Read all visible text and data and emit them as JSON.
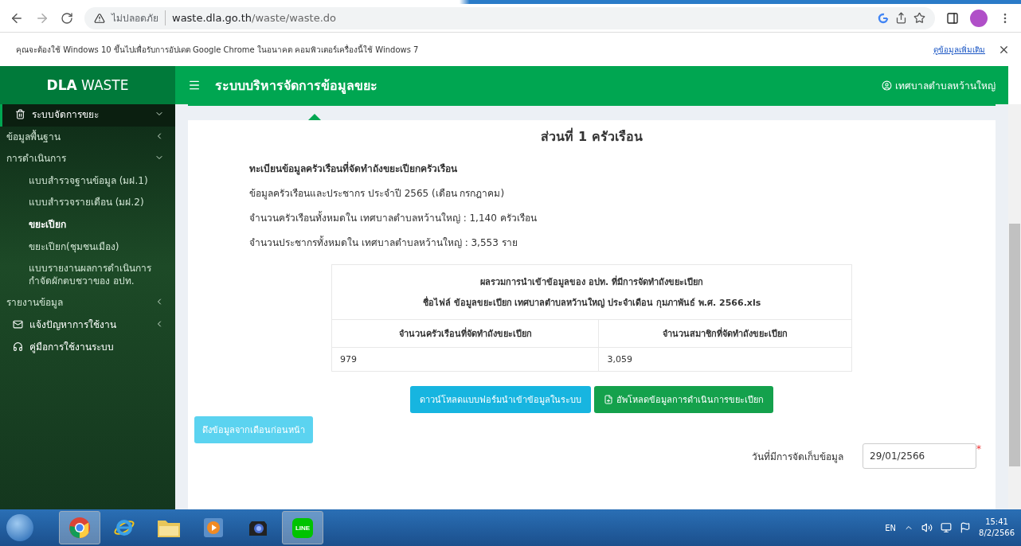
{
  "browser": {
    "security_label": "ไม่ปลอดภัย",
    "url_host": "waste.dla.go.th",
    "url_path": "/waste/waste.do"
  },
  "infobar": {
    "message": "คุณจะต้องใช้ Windows 10 ขึ้นไปเพื่อรับการอัปเดต Google Chrome ในอนาคต คอมพิวเตอร์เครื่องนี้ใช้ Windows 7",
    "link": "ดูข้อมูลเพิ่มเติม"
  },
  "app": {
    "brand_bold": "DLA",
    "brand_rest": "WASTE",
    "title": "ระบบบริหารจัดการข้อมูลขยะ",
    "user": "เทศบาลตำบลหว้านใหญ่"
  },
  "sidebar": {
    "items": [
      {
        "kind": "trash",
        "label": "ระบบจัดการขยะ",
        "expanded": true,
        "children": [
          {
            "label": "ข้อมูลพื้นฐาน",
            "expanded": false
          },
          {
            "label": "การดำเนินการ",
            "expanded": true,
            "children": [
              {
                "label": "แบบสำรวจฐานข้อมูล (มฝ.1)",
                "selected": false
              },
              {
                "label": "แบบสำรวจรายเดือน (มฝ.2)",
                "selected": false
              },
              {
                "label": "ขยะเปียก",
                "selected": true
              },
              {
                "label": "ขยะเปียก(ชุมชนเมือง)",
                "selected": false
              },
              {
                "label": "แบบรายงานผลการดำเนินการกำจัดผักตบชวาของ อปท.",
                "selected": false
              }
            ]
          },
          {
            "label": "รายงานข้อมูล",
            "expanded": false
          }
        ]
      },
      {
        "kind": "mail",
        "label": "แจ้งปัญหาการใช้งาน",
        "expanded": false
      },
      {
        "kind": "help",
        "label": "คู่มือการใช้งานระบบ"
      }
    ]
  },
  "content": {
    "section_title": "ส่วนที่ 1 ครัวเรือน",
    "heading": "ทะเบียนข้อมูลครัวเรือนที่จัดทำถังขยะเปียกครัวเรือน",
    "lines": [
      "ข้อมูลครัวเรือนและประชากร ประจำปี 2565 (เดือน กรกฎาคม)",
      "จำนวนครัวเรือนทั้งหมดใน เทศบาลตำบลหว้านใหญ่ : 1,140 ครัวเรือน",
      "จำนวนประชากรทั้งหมดใน เทศบาลตำบลหว้านใหญ่ : 3,553 ราย"
    ],
    "summary_table": {
      "title": "ผลรวมการนำเข้าข้อมูลของ อปท. ที่มีการจัดทำถังขยะเปียก",
      "file_name": "ชื่อไฟล์ ข้อมูลขยะเปียก เทศบาลตำบลหว้านใหญ่ ประจำเดือน กุมภาพันธ์ พ.ศ. 2566.xls",
      "columns": [
        "จำนวนครัวเรือนที่จัดทำถังขยะเปียก",
        "จำนวนสมาชิกที่จัดทำถังขยะเปียก"
      ],
      "rows": [
        [
          "979",
          "3,059"
        ]
      ]
    },
    "buttons": [
      {
        "kind": "info",
        "label": "ดาวน์โหลดแบบฟอร์มนำเข้าข้อมูลในระบบ"
      },
      {
        "kind": "success",
        "label": "อัพโหลดข้อมูลการดำเนินการขยะเปียก"
      }
    ],
    "prev_button": {
      "label": "ดึงข้อมูลจากเดือนก่อนหน้า",
      "disabled": true
    },
    "date_field": {
      "label": "วันที่มีการจัดเก็บข้อมูล",
      "value": "29/01/2566",
      "required": true,
      "required_mark": "*"
    }
  },
  "taskbar": {
    "apps": [
      {
        "kind": "chrome",
        "active": true
      },
      {
        "kind": "ie",
        "active": false
      },
      {
        "kind": "folder",
        "active": false
      },
      {
        "kind": "media",
        "active": false
      },
      {
        "kind": "camera",
        "active": false
      },
      {
        "kind": "line",
        "label": "LINE",
        "active": true
      }
    ],
    "lang": "EN",
    "time": "15:41",
    "date": "8/2/2566"
  }
}
